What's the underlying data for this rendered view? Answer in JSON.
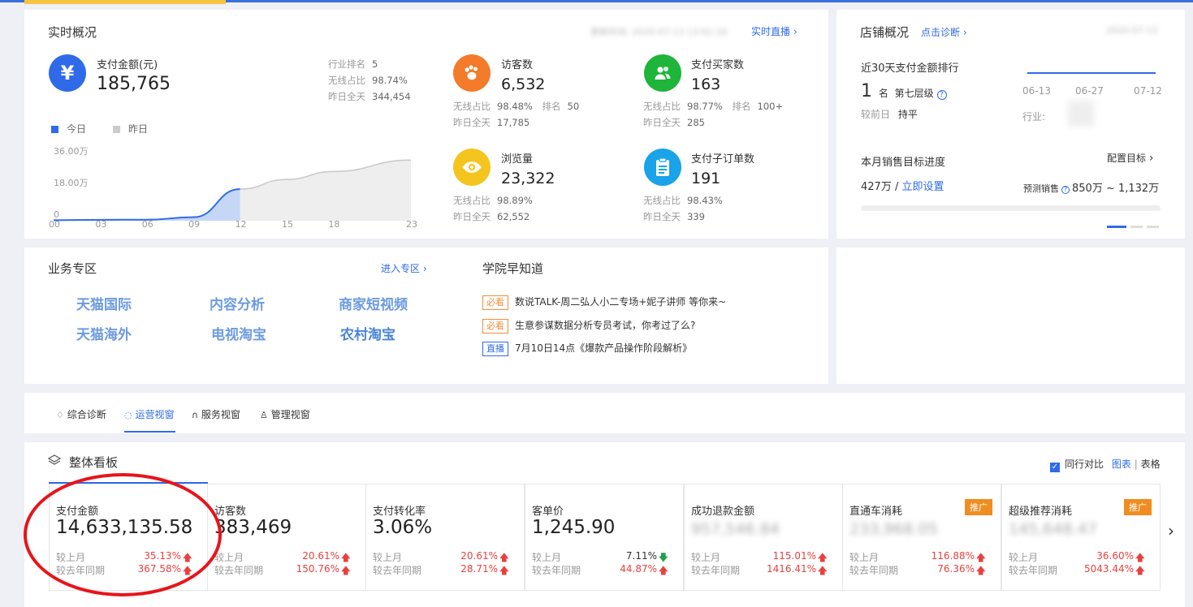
{
  "realtime": {
    "title": "实时概况",
    "update_time": "更新时间: 2020-07-13 13:01:18",
    "live_link": "实时直播",
    "payment": {
      "label": "支付金额(元)",
      "value": "185,765",
      "industry_rank_label": "行业排名",
      "industry_rank": "5",
      "wireless_label": "无线占比",
      "wireless": "98.74%",
      "yesterday_label": "昨日全天",
      "yesterday": "344,454"
    },
    "legend": {
      "today": "今日",
      "yesterday": "昨日"
    },
    "chart": {
      "yticks": [
        "36.00万",
        "18.00万",
        "0"
      ],
      "xticks": [
        "00",
        "03",
        "06",
        "09",
        "12",
        "15",
        "18",
        "23"
      ]
    },
    "metrics": [
      {
        "label": "访客数",
        "value": "6,532",
        "row1_label": "无线占比",
        "row1_value": "98.48%",
        "rank_label": "排名",
        "rank_value": "50",
        "row2_label": "昨日全天",
        "row2_value": "17,785"
      },
      {
        "label": "支付买家数",
        "value": "163",
        "row1_label": "无线占比",
        "row1_value": "98.77%",
        "rank_label": "排名",
        "rank_value": "100+",
        "row2_label": "昨日全天",
        "row2_value": "285"
      },
      {
        "label": "浏览量",
        "value": "23,322",
        "row1_label": "无线占比",
        "row1_value": "98.89%",
        "row2_label": "昨日全天",
        "row2_value": "62,552"
      },
      {
        "label": "支付子订单数",
        "value": "191",
        "row1_label": "无线占比",
        "row1_value": "98.43%",
        "row2_label": "昨日全天",
        "row2_value": "339"
      }
    ]
  },
  "realtime_chart_data": {
    "type": "line",
    "x": [
      0,
      3,
      6,
      9,
      12,
      15,
      18,
      23
    ],
    "series": [
      {
        "name": "今日",
        "values": [
          0.3,
          0.5,
          0.6,
          2.0,
          18.0
        ]
      },
      {
        "name": "昨日",
        "values": [
          0.3,
          0.5,
          0.6,
          2.0,
          18.0,
          23.5,
          28.0,
          34.5
        ]
      }
    ],
    "ylim": [
      0,
      36
    ]
  },
  "store": {
    "title": "店铺概况",
    "diagnose_link": "点击诊断",
    "date": "2020-07-12",
    "rank_title": "近30天支付金额排行",
    "rank_value": "1",
    "rank_unit": "名",
    "level": "第七层级",
    "compare_label": "较前日",
    "compare_value": "持平",
    "industry_label": "行业:",
    "dates": [
      "06-13",
      "06-27",
      "07-12"
    ],
    "target_title": "本月销售目标进度",
    "config_link": "配置目标",
    "target_value": "427万",
    "set_link": "立即设置",
    "forecast_label": "预测销售",
    "forecast_value": "850万 ~ 1,132万"
  },
  "business": {
    "title": "业务专区",
    "enter_link": "进入专区",
    "items": [
      "天猫国际",
      "内容分析",
      "商家短视频",
      "天猫海外",
      "电视淘宝",
      "农村淘宝"
    ]
  },
  "academy": {
    "title": "学院早知道",
    "news": [
      {
        "tag": "必看",
        "text": "数说TALK-周二弘人小二专场+妮子讲师 等你来~"
      },
      {
        "tag": "必看",
        "text": "生意参谋数据分析专员考试，你考过了么?"
      },
      {
        "tag": "直播",
        "text": "7月10日14点《爆款产品操作阶段解析》"
      }
    ]
  },
  "tabs": [
    "综合诊断",
    "运营视窗",
    "服务视窗",
    "管理视窗"
  ],
  "board": {
    "title": "整体看板",
    "peer_compare": "同行对比",
    "chart_link": "图表",
    "table_link": "表格",
    "badge": "推广",
    "mom_label": "较上月",
    "yoy_label": "较去年同期",
    "kpis": [
      {
        "label": "支付金额",
        "value": "14,633,135.58",
        "mom": "35.13%",
        "yoy": "367.58%"
      },
      {
        "label": "访客数",
        "value": "383,469",
        "mom": "20.61%",
        "yoy": "150.76%"
      },
      {
        "label": "支付转化率",
        "value": "3.06%",
        "mom": "20.61%",
        "yoy": "28.71%"
      },
      {
        "label": "客单价",
        "value": "1,245.90",
        "mom": "7.11%",
        "yoy": "44.87%"
      },
      {
        "label": "成功退款金额",
        "value": "957,546.84",
        "mom": "115.01%",
        "yoy": "1416.41%"
      },
      {
        "label": "直通车消耗",
        "value": "233,968.05",
        "mom": "116.88%",
        "yoy": "76.36%"
      },
      {
        "label": "超级推荐消耗",
        "value": "145,648.47",
        "mom": "36.60%",
        "yoy": "5043.44%"
      }
    ]
  },
  "colors": {
    "accent": "#2f6be8",
    "up": "#e94040",
    "down": "#1fa04a",
    "highlight_circle": "#e8141b",
    "badge": "#f08d21"
  }
}
